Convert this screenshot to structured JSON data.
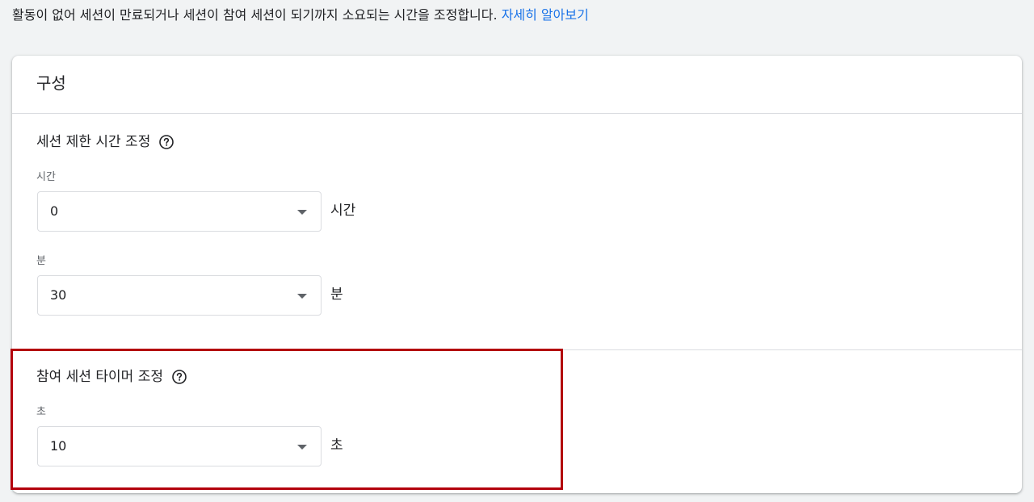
{
  "intro": {
    "description": "활동이 없어 세션이 만료되거나 세션이 참여 세션이 되기까지 소요되는 시간을 조정합니다.",
    "learn_more": "자세히 알아보기"
  },
  "card": {
    "title": "구성",
    "session_timeout": {
      "heading": "세션 제한 시간 조정",
      "help_icon": "help-circle-icon",
      "hours": {
        "label": "시간",
        "value": "0",
        "unit": "시간"
      },
      "minutes": {
        "label": "분",
        "value": "30",
        "unit": "분"
      }
    },
    "engaged_session": {
      "heading": "참여 세션 타이머 조정",
      "help_icon": "help-circle-icon",
      "seconds": {
        "label": "초",
        "value": "10",
        "unit": "초"
      }
    }
  },
  "colors": {
    "link": "#1a73e8",
    "highlight_border": "#b3000c",
    "background": "#f1f3f4"
  }
}
